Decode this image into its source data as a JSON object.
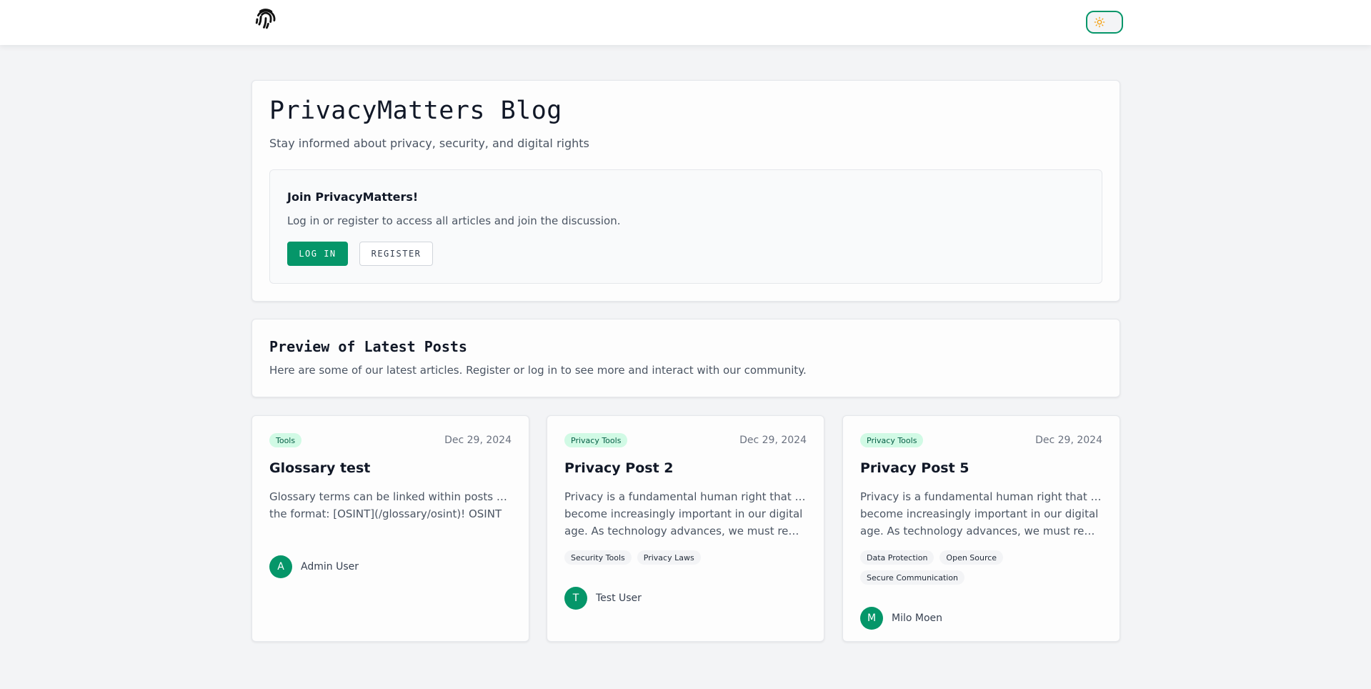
{
  "header": {
    "logo_icon": "fingerprint-icon",
    "theme_toggle_icon": "sun-icon",
    "accent_color": "#059669"
  },
  "hero": {
    "title": "PrivacyMatters Blog",
    "subtitle": "Stay informed about privacy, security, and digital rights",
    "join": {
      "title": "Join PrivacyMatters!",
      "text": "Log in or register to access all articles and join the discussion.",
      "login_label": "LOG IN",
      "register_label": "REGISTER"
    }
  },
  "preview": {
    "title": "Preview of Latest Posts",
    "text": "Here are some of our latest articles. Register or log in to see more and interact with our community."
  },
  "posts": [
    {
      "category": "Tools",
      "date": "Dec 29, 2024",
      "title": "Glossary test",
      "excerpt_lines": [
        "Glossary terms can be linked within posts using",
        "the format: [OSINT](/glossary/osint)! OSINT"
      ],
      "tags": [],
      "author_initial": "A",
      "author_name": "Admin User"
    },
    {
      "category": "Privacy Tools",
      "date": "Dec 29, 2024",
      "title": "Privacy Post 2",
      "excerpt_lines": [
        "Privacy is a fundamental human right that has",
        "become increasingly important in our digital",
        "age. As technology advances, we must remai..."
      ],
      "tags": [
        "Security Tools",
        "Privacy Laws"
      ],
      "author_initial": "T",
      "author_name": "Test User"
    },
    {
      "category": "Privacy Tools",
      "date": "Dec 29, 2024",
      "title": "Privacy Post 5",
      "excerpt_lines": [
        "Privacy is a fundamental human right that has",
        "become increasingly important in our digital",
        "age. As technology advances, we must remai..."
      ],
      "tags": [
        "Data Protection",
        "Open Source",
        "Secure Communication"
      ],
      "author_initial": "M",
      "author_name": "Milo Moen"
    }
  ]
}
